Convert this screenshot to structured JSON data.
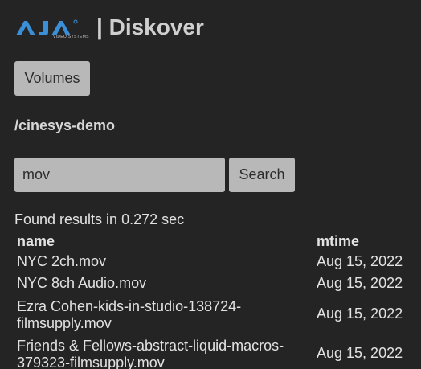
{
  "header": {
    "logo_text": "AJA",
    "logo_subtext": "VIDEO SYSTEMS",
    "title": "| Diskover",
    "brand_color": "#3a8fd6"
  },
  "nav": {
    "volumes_label": "Volumes"
  },
  "path": "/cinesys-demo",
  "search": {
    "value": "mov",
    "button_label": "Search"
  },
  "results": {
    "status": "Found results in 0.272 sec",
    "columns": [
      "name",
      "mtime"
    ],
    "rows": [
      {
        "name": "NYC 2ch.mov",
        "mtime": "Aug 15, 2022"
      },
      {
        "name": "NYC 8ch Audio.mov",
        "mtime": "Aug 15, 2022"
      },
      {
        "name": "Ezra Cohen-kids-in-studio-138724-filmsupply.mov",
        "mtime": "Aug 15, 2022"
      },
      {
        "name": "Friends & Fellows-abstract-liquid-macros-379323-filmsupply.mov",
        "mtime": "Aug 15, 2022"
      }
    ]
  }
}
